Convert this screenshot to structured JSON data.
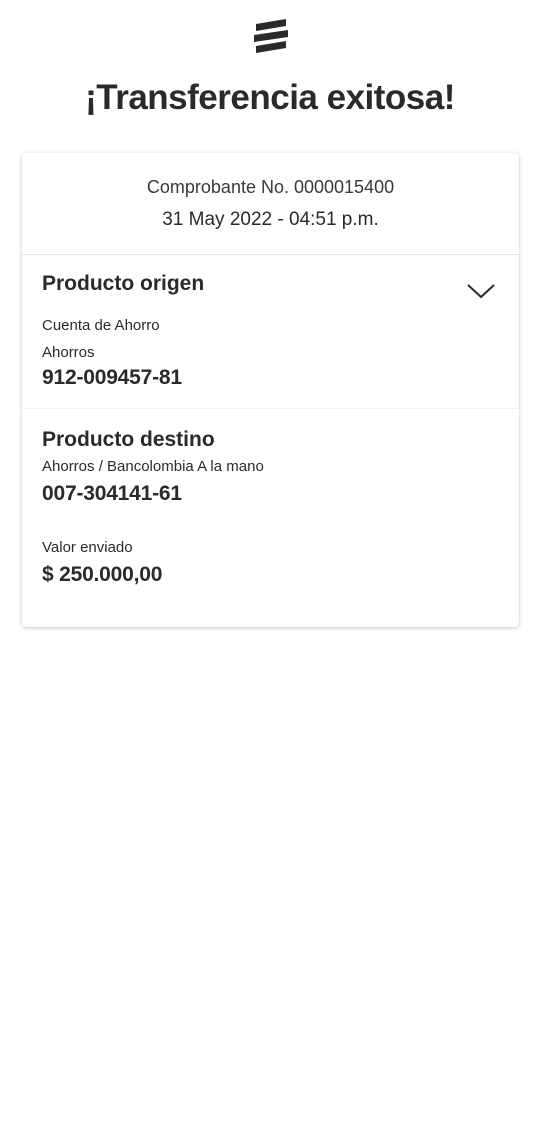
{
  "header": {
    "logo_icon": "bancolombia-logo-icon",
    "title": "¡Transferencia exitosa!"
  },
  "receipt": {
    "number_label": "Comprobante No. 0000015400",
    "datetime": "31 May 2022 - 04:51 p.m."
  },
  "origin": {
    "title": "Producto origen",
    "account_type": "Cuenta de Ahorro",
    "product_name": "Ahorros",
    "account_number": "912-009457-81",
    "toggle_icon": "chevron-down-icon"
  },
  "destination": {
    "title": "Producto destino",
    "product_name": "Ahorros / Bancolombia A la mano",
    "account_number": "007-304141-61"
  },
  "amount": {
    "label": "Valor enviado",
    "value": "$ 250.000,00"
  },
  "colors": {
    "text": "#2c2a29",
    "background": "#ffffff",
    "divider": "#e6e6e6"
  }
}
